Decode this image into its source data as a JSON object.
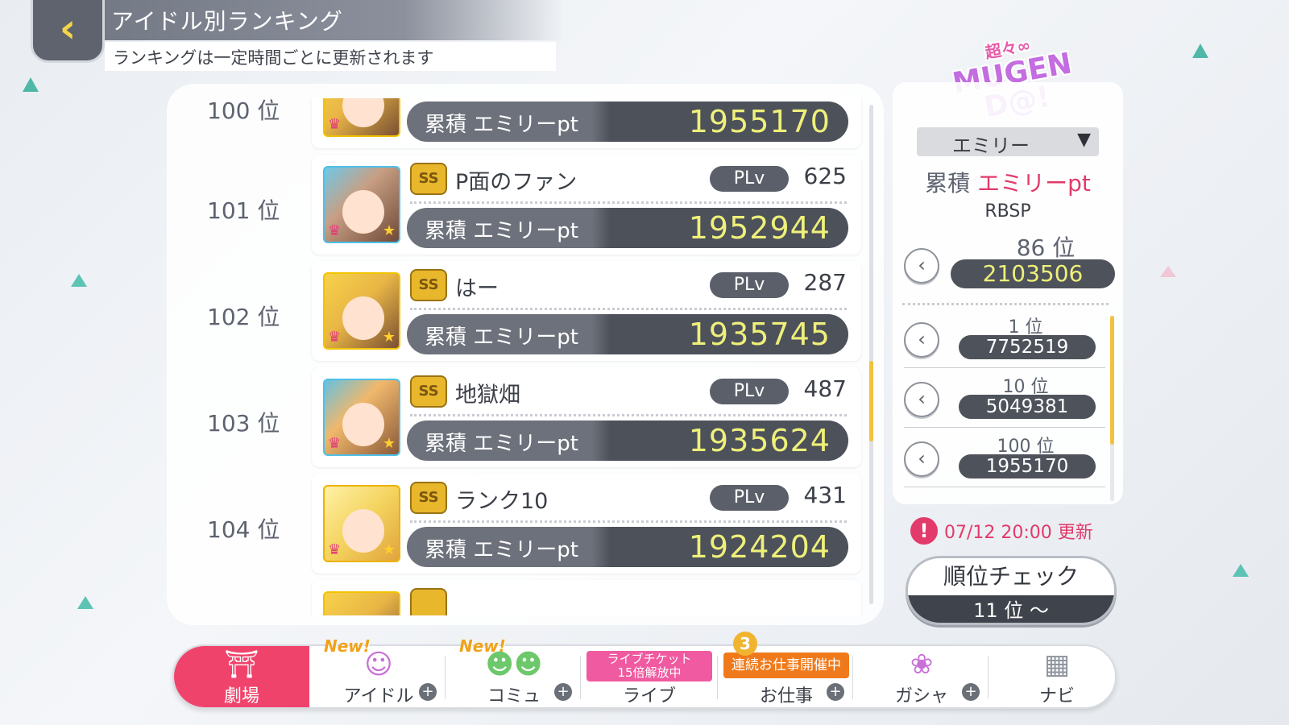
{
  "header": {
    "back_icon": "chevron-left-icon",
    "title": "アイドル別ランキング",
    "subtitle": "ランキングは一定時間ごとに更新されます"
  },
  "ranking": {
    "entries": [
      {
        "rank": "100 位",
        "name": "",
        "plv": "",
        "pt_label": "累積 エミリーpt",
        "pt": "1955170",
        "avatar_style": "gold"
      },
      {
        "rank": "101 位",
        "name": "P面のファン",
        "plv": "625",
        "pt_label": "累積 エミリーpt",
        "pt": "1952944",
        "avatar_style": "brown"
      },
      {
        "rank": "102 位",
        "name": "はー",
        "plv": "287",
        "pt_label": "累積 エミリーpt",
        "pt": "1935745",
        "avatar_style": "gold"
      },
      {
        "rank": "103 位",
        "name": "地獄畑",
        "plv": "487",
        "pt_label": "累積 エミリーpt",
        "pt": "1935624",
        "avatar_style": "orange"
      },
      {
        "rank": "104 位",
        "name": "ランク10",
        "plv": "431",
        "pt_label": "累積 エミリーpt",
        "pt": "1924204",
        "avatar_style": "yellow"
      }
    ],
    "plv_label": "PLv",
    "medal_label": "SS"
  },
  "event": {
    "logo_top": "超々∞",
    "logo_main": "MUGEN D@!"
  },
  "side": {
    "idol_select_value": "エミリー",
    "metric_prefix": "累積 ",
    "metric_highlight": "エミリーpt",
    "unit_name": "RBSP",
    "my_rank": "86 位",
    "my_score": "2103506",
    "benchmarks": [
      {
        "rank": "1 位",
        "score": "7752519"
      },
      {
        "rank": "10 位",
        "score": "5049381"
      },
      {
        "rank": "100 位",
        "score": "1955170"
      }
    ],
    "update_text": "07/12 20:00 更新",
    "check_button_top": "順位チェック",
    "check_button_bottom": "11 位 ～"
  },
  "nav": {
    "items": [
      {
        "label": "劇場",
        "icon": "theater-icon"
      },
      {
        "label": "アイドル",
        "icon": "idol-icon",
        "badge": "New!"
      },
      {
        "label": "コミュ",
        "icon": "commu-icon",
        "badge": "New!"
      },
      {
        "label": "ライブ",
        "icon": "live-icon",
        "banner": "ライブチケット\n15倍解放中"
      },
      {
        "label": "お仕事",
        "icon": "work-icon",
        "banner": "連続お仕事開催中",
        "count": "3"
      },
      {
        "label": "ガシャ",
        "icon": "gacha-icon"
      },
      {
        "label": "ナビ",
        "icon": "navi-icon"
      }
    ]
  },
  "colors": {
    "accent_pink": "#e23a6a",
    "score_yellow": "#eef07a",
    "nav_active": "#f0436b"
  }
}
